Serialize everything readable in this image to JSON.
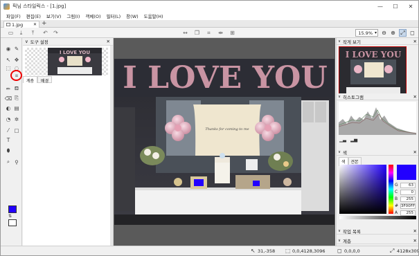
{
  "window": {
    "title": "픽님 스타일릭스 - [1.jpg]",
    "buttons": [
      "—",
      "☐",
      "✕"
    ]
  },
  "menu": {
    "items": [
      "파일(F)",
      "편집(E)",
      "보기(V)",
      "그림(I)",
      "객체(O)",
      "필터(L)",
      "창(W)",
      "도움말(H)"
    ]
  },
  "tabs": {
    "doc_name": "1.jpg",
    "add": "+"
  },
  "toolbar": {
    "zoom": "15.9%"
  },
  "tool_settings": {
    "title": "도구 설정",
    "tabs": [
      "계층",
      "배경"
    ]
  },
  "navigator": {
    "title": "작게 보기"
  },
  "histogram": {
    "title": "히스토그램"
  },
  "color": {
    "title": "색",
    "tabs": [
      "색",
      "견본"
    ],
    "fg": "#2200ff",
    "rows": [
      {
        "label": "G",
        "value": "63"
      },
      {
        "label": "C",
        "value": "0"
      },
      {
        "label": "B",
        "value": "255"
      },
      {
        "label": "#",
        "value": "3F00FF"
      },
      {
        "label": "A",
        "value": "255"
      }
    ]
  },
  "work_list": {
    "title": "작업 목록"
  },
  "layers": {
    "title": "계층"
  },
  "photo": {
    "banner": "I LOVE YOU",
    "cloth_text": "Thanks for coming to me"
  },
  "status": {
    "cursor": "31,-358",
    "selection": "0,0,4128,3096",
    "pixel": "0,0,0,0",
    "size": "4128x3096"
  }
}
